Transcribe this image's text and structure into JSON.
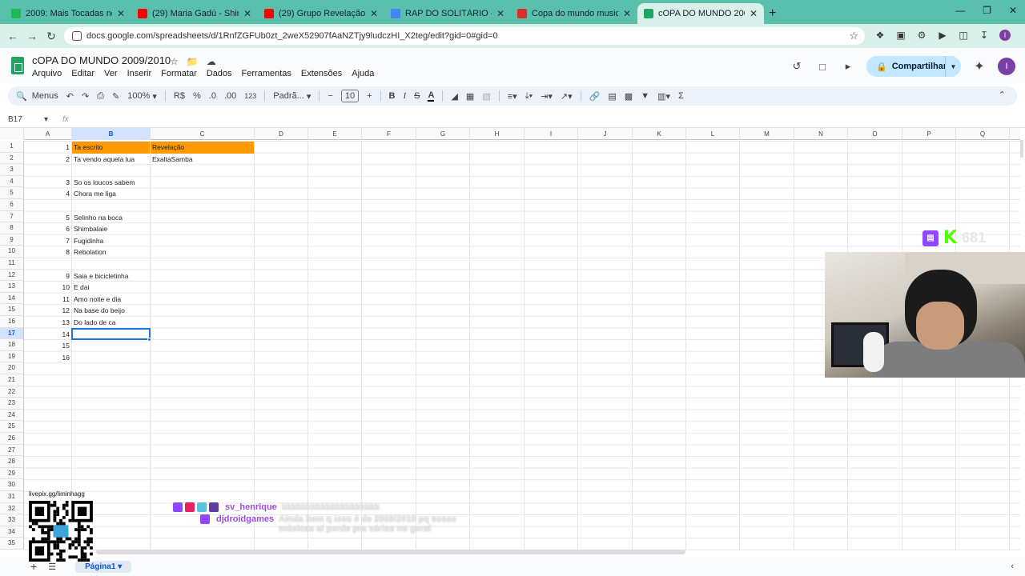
{
  "browser": {
    "tabs": [
      {
        "title": "2009: Mais Tocadas no Brasil - J",
        "color": "#1db954"
      },
      {
        "title": "(29) Maria Gadú - Shimbalaiê [",
        "color": "#ff0000"
      },
      {
        "title": "(29) Grupo Revelação - Tá Escr",
        "color": "#ff0000"
      },
      {
        "title": "RAP DO SOLITÁRIO - Pesquisa",
        "color": "#4285f4"
      },
      {
        "title": "Copa do mundo musicas brasil",
        "color": "#d93025"
      },
      {
        "title": "cOPA DO MUNDO 2009/2010 -",
        "color": "#1fa463"
      }
    ],
    "url": "docs.google.com/spreadsheets/d/1RnfZGFUb0zt_2weX52907fAaNZTjy9ludczHI_X2teg/edit?gid=0#gid=0"
  },
  "doc": {
    "title": "cOPA DO MUNDO 2009/2010",
    "menu": [
      "Arquivo",
      "Editar",
      "Ver",
      "Inserir",
      "Formatar",
      "Dados",
      "Ferramentas",
      "Extensões",
      "Ajuda"
    ],
    "share_label": "Compartilhar",
    "avatar_letter": "I"
  },
  "toolbar": {
    "menus": "Menus",
    "zoom": "100%",
    "currency": "R$",
    "percent": "%",
    "dec_less": ".0",
    "dec_more": ".00",
    "format_num": "123",
    "font": "Padrã...",
    "font_size": "10",
    "bold": "B",
    "italic": "I"
  },
  "formula": {
    "cell_ref": "B17",
    "fx": "fx"
  },
  "grid": {
    "columns": [
      "A",
      "B",
      "C",
      "D",
      "E",
      "F",
      "G",
      "H",
      "I",
      "J",
      "K",
      "L",
      "M",
      "N",
      "O",
      "P",
      "Q"
    ],
    "rows": [
      "1",
      "2",
      "3",
      "4",
      "5",
      "6",
      "7",
      "8",
      "9",
      "10",
      "11",
      "12",
      "13",
      "14",
      "15",
      "16",
      "17",
      "18",
      "19",
      "20",
      "21",
      "22",
      "23",
      "24",
      "25",
      "26",
      "27",
      "28",
      "29",
      "30",
      "31",
      "32",
      "33",
      "34",
      "35"
    ],
    "header_color": "#ff9900",
    "cells": [
      {
        "row": 1,
        "col": "A",
        "value": "1"
      },
      {
        "row": 1,
        "col": "B",
        "value": "Ta escrito",
        "hdr": true
      },
      {
        "row": 1,
        "col": "C",
        "value": "Revelação",
        "hdr": true
      },
      {
        "row": 2,
        "col": "A",
        "value": "2"
      },
      {
        "row": 2,
        "col": "B",
        "value": "Ta vendo aquela lua"
      },
      {
        "row": 2,
        "col": "C",
        "value": "ExaltaSamba"
      },
      {
        "row": 4,
        "col": "A",
        "value": "3"
      },
      {
        "row": 4,
        "col": "B",
        "value": "So os loucos sabem"
      },
      {
        "row": 5,
        "col": "A",
        "value": "4"
      },
      {
        "row": 5,
        "col": "B",
        "value": "Chora me liga"
      },
      {
        "row": 7,
        "col": "A",
        "value": "5"
      },
      {
        "row": 7,
        "col": "B",
        "value": "Selinho na boca"
      },
      {
        "row": 8,
        "col": "A",
        "value": "6"
      },
      {
        "row": 8,
        "col": "B",
        "value": "Shimbalaie"
      },
      {
        "row": 9,
        "col": "A",
        "value": "7"
      },
      {
        "row": 9,
        "col": "B",
        "value": "Fugidinha"
      },
      {
        "row": 10,
        "col": "A",
        "value": "8"
      },
      {
        "row": 10,
        "col": "B",
        "value": "Rebolation"
      },
      {
        "row": 12,
        "col": "A",
        "value": "9"
      },
      {
        "row": 12,
        "col": "B",
        "value": "Saia e bicicletinha"
      },
      {
        "row": 13,
        "col": "A",
        "value": "10"
      },
      {
        "row": 13,
        "col": "B",
        "value": "E dai"
      },
      {
        "row": 14,
        "col": "A",
        "value": "11"
      },
      {
        "row": 14,
        "col": "B",
        "value": "Amo noite e dia"
      },
      {
        "row": 15,
        "col": "A",
        "value": "12"
      },
      {
        "row": 15,
        "col": "B",
        "value": "Na base do beijo"
      },
      {
        "row": 16,
        "col": "A",
        "value": "13"
      },
      {
        "row": 16,
        "col": "B",
        "value": "Do lado de ca"
      },
      {
        "row": 17,
        "col": "A",
        "value": "14"
      },
      {
        "row": 18,
        "col": "A",
        "value": "15"
      },
      {
        "row": 19,
        "col": "A",
        "value": "16"
      }
    ],
    "selected": {
      "row": 17,
      "col": "B"
    }
  },
  "sheets": {
    "active_tab": "Página1"
  },
  "overlay": {
    "qr_label": "livepix.gg/liminhagg",
    "kick_count": "681",
    "chat": [
      {
        "user": "sv_henrique",
        "message": "kkkkkkkkkkkkkkkkkkkk"
      },
      {
        "user": "djdroidgames",
        "message": "Ainda bem q isso é de 2009/2010 pq essas músicas ai perde pra várias no geral"
      }
    ]
  }
}
